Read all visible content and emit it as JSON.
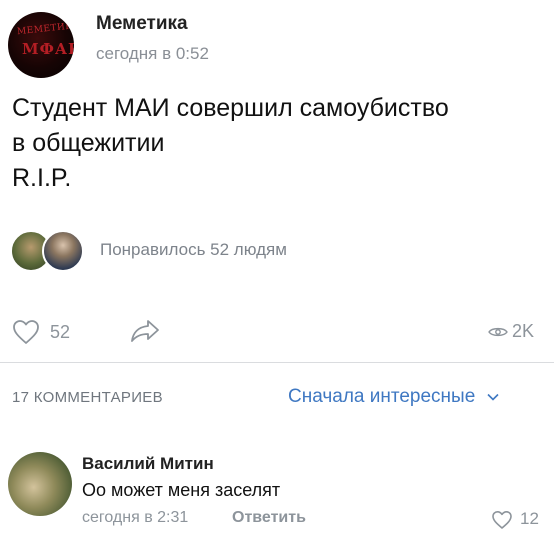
{
  "post": {
    "author": "Меметика",
    "avatar_text_top": "МЕМЕТИКА",
    "avatar_text_bottom": "МФАК",
    "time": "сегодня в 0:52",
    "text_lines": [
      "Студент МАИ совершил самоубиство",
      "в общежитии",
      "R.I.P."
    ],
    "likes_text": "Понравилось 52 людям",
    "like_count": "52",
    "views": "2K"
  },
  "comments_section": {
    "count_label": "17 КОММЕНТАРИЕВ",
    "sort_label": "Сначала интересные",
    "sort_chevron": "⌄"
  },
  "comment": {
    "author": "Василий Митин",
    "text": "Оо может меня заселят",
    "time": "сегодня в 2:31",
    "reply_label": "Ответить",
    "likes": "12"
  },
  "colors": {
    "link": "#3f78c2",
    "muted": "#8d949b"
  },
  "icons": [
    "heart-icon",
    "share-icon",
    "eye-icon",
    "chevron-down-icon"
  ]
}
